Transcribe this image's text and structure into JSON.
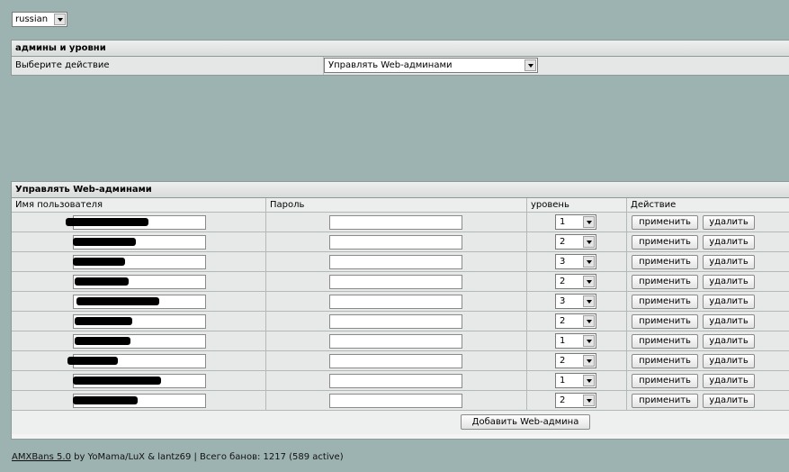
{
  "language": {
    "selected": "russian"
  },
  "panel1": {
    "title": "админы и уровни",
    "label": "Выберите действие",
    "action_selected": "Управлять Web-админами"
  },
  "panel2": {
    "title": "Управлять Web-админами",
    "columns": [
      "Имя пользователя",
      "Пароль",
      "уровень",
      "Действие"
    ],
    "apply_label": "применить",
    "delete_label": "удалить",
    "add_label": "Добавить Web-админа",
    "rows": [
      {
        "level": "1"
      },
      {
        "level": "2"
      },
      {
        "level": "3"
      },
      {
        "level": "2"
      },
      {
        "level": "3"
      },
      {
        "level": "2"
      },
      {
        "level": "1"
      },
      {
        "level": "2"
      },
      {
        "level": "1"
      },
      {
        "level": "2"
      }
    ]
  },
  "footer": {
    "link": "AMXBans 5.0",
    "text": " by YoMama/LuX & lantz69 | Всего банов: 1217 (589 active)"
  },
  "icons": {
    "dropdown": "chevron-down-icon",
    "redaction": "redaction-mark"
  }
}
